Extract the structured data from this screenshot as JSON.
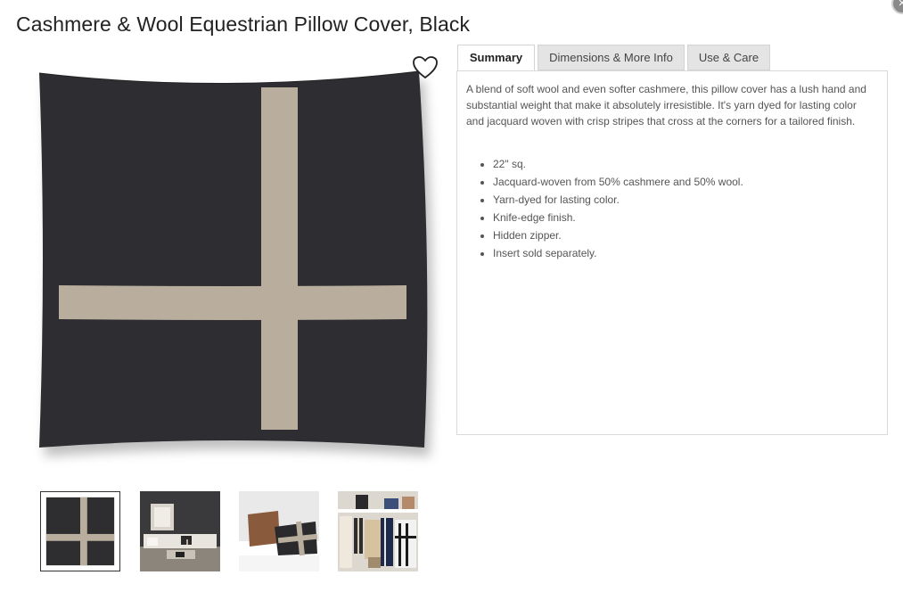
{
  "product": {
    "title": "Cashmere & Wool Equestrian Pillow Cover, Black"
  },
  "close_button": {
    "icon": "close-icon",
    "label": "✕"
  },
  "favorite": {
    "icon": "heart-outline-icon"
  },
  "tabs": [
    {
      "label": "Summary",
      "active": true
    },
    {
      "label": "Dimensions & More Info",
      "active": false
    },
    {
      "label": "Use & Care",
      "active": false
    }
  ],
  "summary": {
    "description": "A blend of soft wool and even softer cashmere, this pillow cover has a lush hand and substantial weight that make it absolutely irresistible. It's yarn dyed for lasting color and jacquard woven with crisp stripes that cross at the corners for a tailored finish.",
    "features": [
      "22\" sq.",
      "Jacquard-woven from 50% cashmere and 50% wool.",
      "Yarn-dyed for lasting color.",
      "Knife-edge finish.",
      "Hidden zipper.",
      "Insert sold separately."
    ]
  },
  "thumbnails": [
    {
      "name": "thumbnail-pillow-front",
      "selected": true
    },
    {
      "name": "thumbnail-living-room",
      "selected": false
    },
    {
      "name": "thumbnail-sofa-pillows",
      "selected": false
    },
    {
      "name": "thumbnail-shelf-textiles",
      "selected": false
    }
  ],
  "colors": {
    "pillow_body": "#2e2e30",
    "stripe": "#b9ad9d",
    "tab_inactive": "#e4e4e4",
    "panel_border": "#d9d9d9"
  }
}
